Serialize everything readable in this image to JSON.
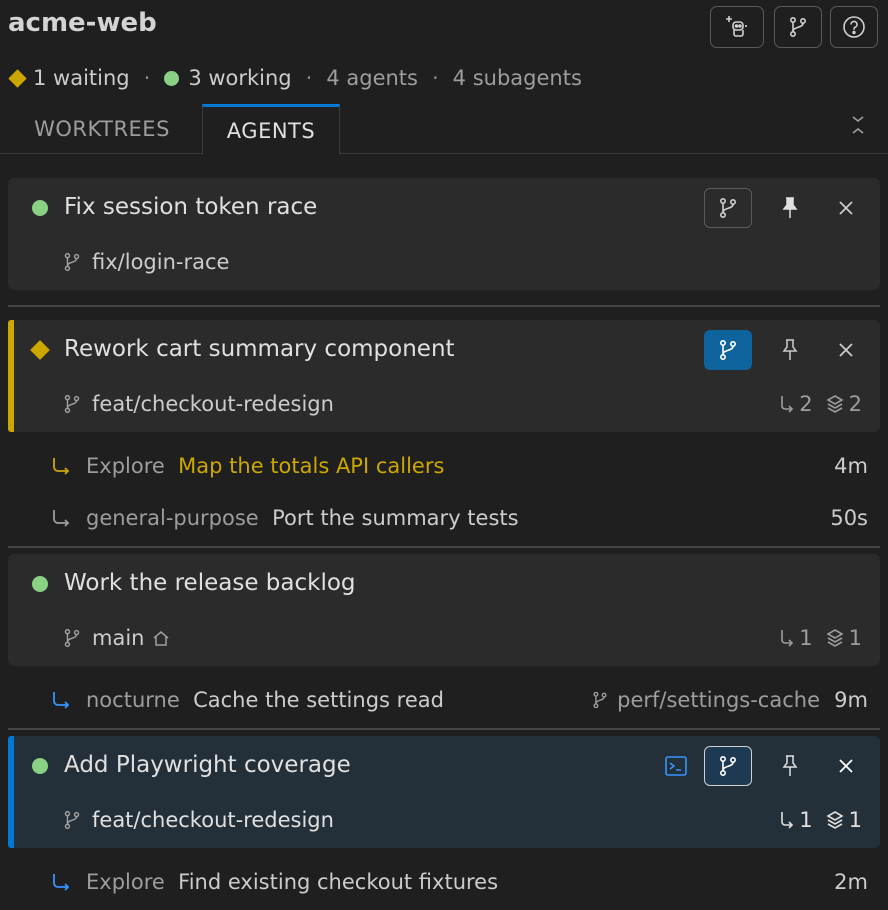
{
  "header": {
    "title": "acme-web",
    "status": {
      "waiting": "1 waiting",
      "working": "3 working",
      "agents": "4 agents",
      "subagents": "4 subagents",
      "separator": "·"
    }
  },
  "tabs": [
    {
      "label": "WORKTREES",
      "active": false
    },
    {
      "label": "AGENTS",
      "active": true
    }
  ],
  "cards": [
    {
      "title": "Fix session token race",
      "branch": "fix/login-race",
      "status": "working"
    },
    {
      "title": "Rework cart summary component",
      "branch": "feat/checkout-redesign",
      "status": "waiting",
      "subagent_count": "2",
      "stack_count": "2"
    },
    {
      "title": "Work the release backlog",
      "branch": "main",
      "status": "working",
      "subagent_count": "1",
      "stack_count": "1"
    },
    {
      "title": "Add Playwright coverage",
      "branch": "feat/checkout-redesign",
      "status": "working",
      "subagent_count": "1",
      "stack_count": "1",
      "selected": true
    }
  ],
  "subagents": [
    {
      "type": "Explore",
      "text": "Map the totals API callers",
      "time": "4m"
    },
    {
      "type": "general-purpose",
      "text": "Port the summary tests",
      "time": "50s"
    },
    {
      "type": "nocturne",
      "text": "Cache the settings read",
      "branch": "perf/settings-cache",
      "time": "9m"
    },
    {
      "type": "Explore",
      "text": "Find existing checkout fixtures",
      "time": "2m"
    }
  ],
  "icons": {
    "new_agent": "new-agent-icon",
    "branch": "git-branch-icon",
    "help": "help-icon",
    "pin": "pin-icon",
    "close": "close-icon",
    "terminal": "terminal-icon",
    "subagent_hook": "subagent-hook-icon",
    "stack": "layers-icon",
    "home": "home-icon",
    "collapse": "collapse-all-icon"
  },
  "colors": {
    "accent": "#0078d4",
    "working": "#89d185",
    "waiting": "#cca700",
    "background": "#1f1f1f",
    "card": "#2b2b2b",
    "selected_card": "#232f39"
  }
}
